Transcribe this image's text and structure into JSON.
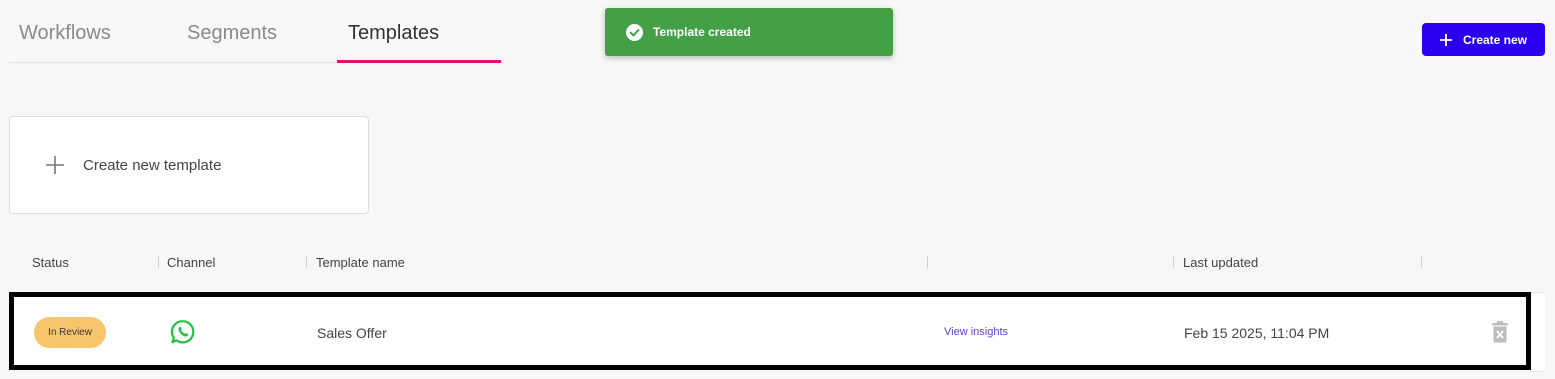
{
  "tabs": [
    {
      "label": "Workflows",
      "active": false
    },
    {
      "label": "Segments",
      "active": false
    },
    {
      "label": "Templates",
      "active": true
    }
  ],
  "toast": {
    "text": "Template created",
    "color": "#43a047",
    "icon": "check-circle-icon"
  },
  "header": {
    "create_label": "Create new",
    "accent": "#2a00ee"
  },
  "new_template": {
    "label": "Create new template"
  },
  "table": {
    "columns": [
      "Status",
      "Channel",
      "Template name",
      "",
      "Last updated"
    ],
    "rows": [
      {
        "status": "In Review",
        "status_color": "#f7c66a",
        "channel_icon": "whatsapp-icon",
        "name": "Sales Offer",
        "action": "View insights",
        "updated": "Feb 15 2025, 11:04 PM"
      }
    ]
  }
}
